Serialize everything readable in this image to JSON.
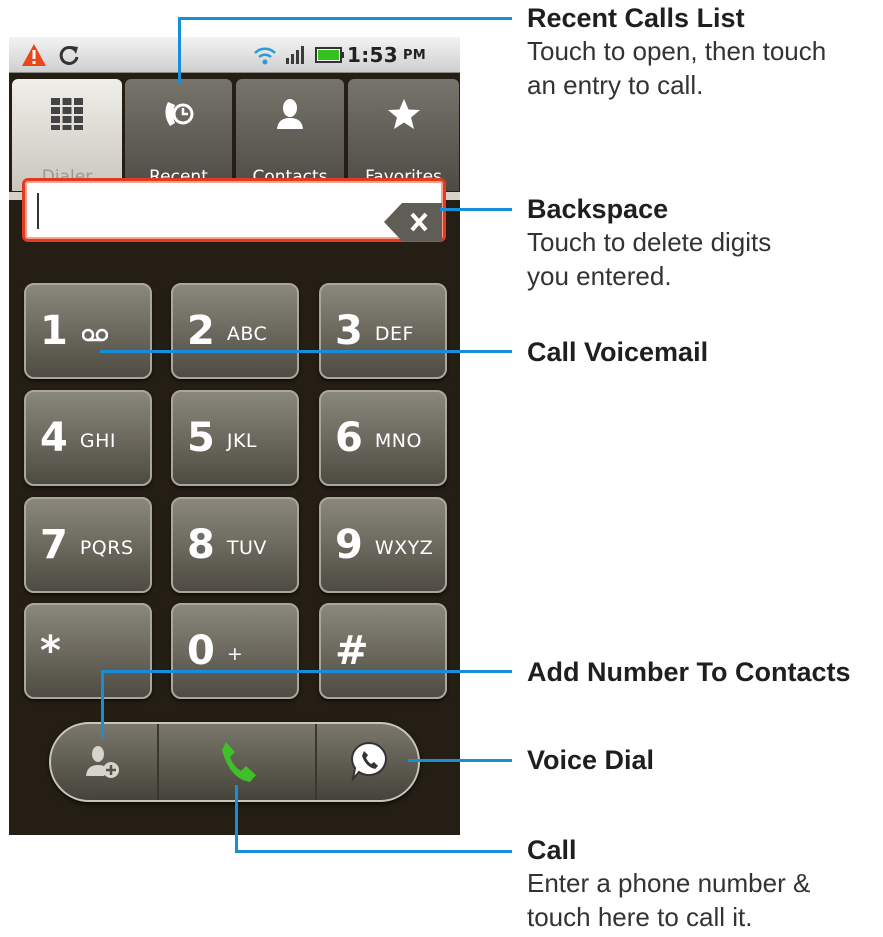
{
  "status_bar": {
    "time": "1:53",
    "ampm": "PM",
    "icons": [
      "alert-icon",
      "sync-icon",
      "wifi-icon",
      "signal-icon",
      "battery-icon"
    ],
    "alert_color": "#e8471c",
    "battery_color": "#36c21e"
  },
  "tabs": [
    {
      "label": "Dialer",
      "icon": "keypad-icon",
      "selected": true
    },
    {
      "label": "Recent",
      "icon": "recent-calls-icon",
      "selected": false
    },
    {
      "label": "Contacts",
      "icon": "contact-person-icon",
      "selected": false
    },
    {
      "label": "Favorites",
      "icon": "star-icon",
      "selected": false
    }
  ],
  "digits_field": {
    "value": ""
  },
  "keypad": [
    {
      "digit": "1",
      "letters": "",
      "icon": "voicemail-icon"
    },
    {
      "digit": "2",
      "letters": "ABC"
    },
    {
      "digit": "3",
      "letters": "DEF"
    },
    {
      "digit": "4",
      "letters": "GHI"
    },
    {
      "digit": "5",
      "letters": "JKL"
    },
    {
      "digit": "6",
      "letters": "MNO"
    },
    {
      "digit": "7",
      "letters": "PQRS"
    },
    {
      "digit": "8",
      "letters": "TUV"
    },
    {
      "digit": "9",
      "letters": "WXYZ"
    },
    {
      "digit": "*",
      "letters": ""
    },
    {
      "digit": "0",
      "letters": "+"
    },
    {
      "digit": "#",
      "letters": ""
    }
  ],
  "action_bar": {
    "icons": [
      "add-contact-icon",
      "phone-call-icon",
      "voice-dial-icon"
    ],
    "call_color": "#3fbf2a"
  },
  "callout_color": "#1590d8",
  "annotations": {
    "recent_calls": {
      "title": "Recent Calls List",
      "body": [
        "Touch to open, then touch",
        "an entry to call."
      ]
    },
    "backspace": {
      "title": "Backspace",
      "body": [
        "Touch to delete digits",
        "you entered."
      ]
    },
    "voicemail": {
      "title": "Call Voicemail"
    },
    "add_number": {
      "title": "Add Number To Contacts"
    },
    "voice_dial": {
      "title": "Voice Dial"
    },
    "call": {
      "title": "Call",
      "body": [
        "Enter a phone number &",
        "touch here to call it."
      ]
    }
  }
}
